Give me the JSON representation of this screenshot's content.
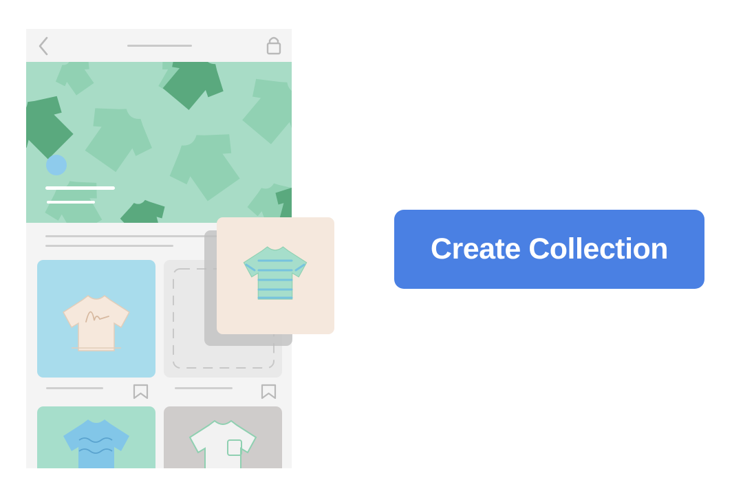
{
  "cta": {
    "label": "Create Collection"
  },
  "colors": {
    "button_blue": "#4a80e3",
    "banner_bg": "#a8dcc6",
    "shirt_dark_green": "#5aa97e",
    "shirt_mid_green": "#86cba8",
    "avatar_blue": "#8ecbec",
    "card_blue": "#a8dcec",
    "card_cream": "#f6e8dc",
    "card_mint": "#a6decb",
    "card_gray": "#cfcccb",
    "phone_bg": "#f4f4f4"
  },
  "icons": {
    "back": "chevron-left-icon",
    "bag": "shopping-bag-icon",
    "bookmark": "bookmark-icon"
  }
}
